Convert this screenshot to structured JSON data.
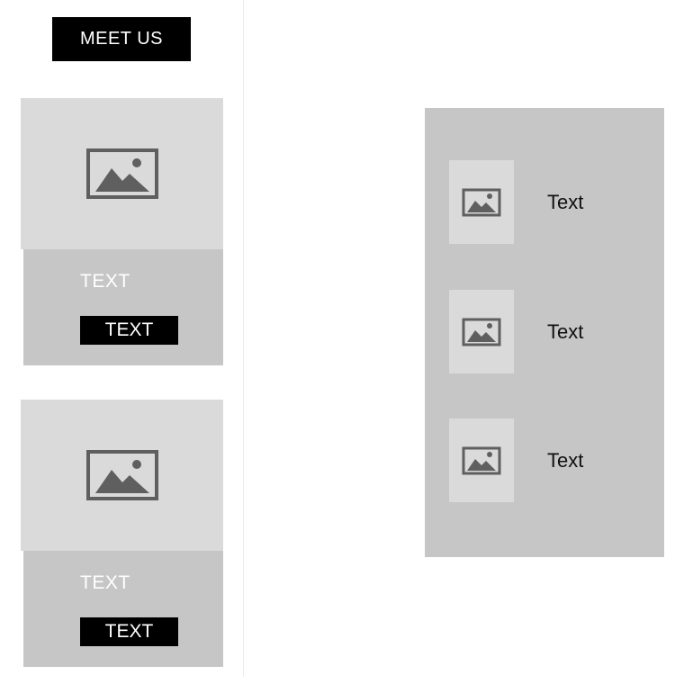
{
  "header": {
    "meet_button_label": "MEET US"
  },
  "cards": [
    {
      "image_icon": "image-icon",
      "title": "TEXT",
      "button_label": "TEXT"
    },
    {
      "image_icon": "image-icon",
      "title": "TEXT",
      "button_label": "TEXT"
    }
  ],
  "list": {
    "items": [
      {
        "image_icon": "image-icon",
        "label": "Text"
      },
      {
        "image_icon": "image-icon",
        "label": "Text"
      },
      {
        "image_icon": "image-icon",
        "label": "Text"
      }
    ]
  },
  "colors": {
    "page_bg": "#ffffff",
    "placeholder_light": "#dadada",
    "placeholder_mid": "#c6c6c6",
    "icon_gray": "#5f5f5f",
    "button_bg": "#000000",
    "button_text": "#ffffff"
  }
}
